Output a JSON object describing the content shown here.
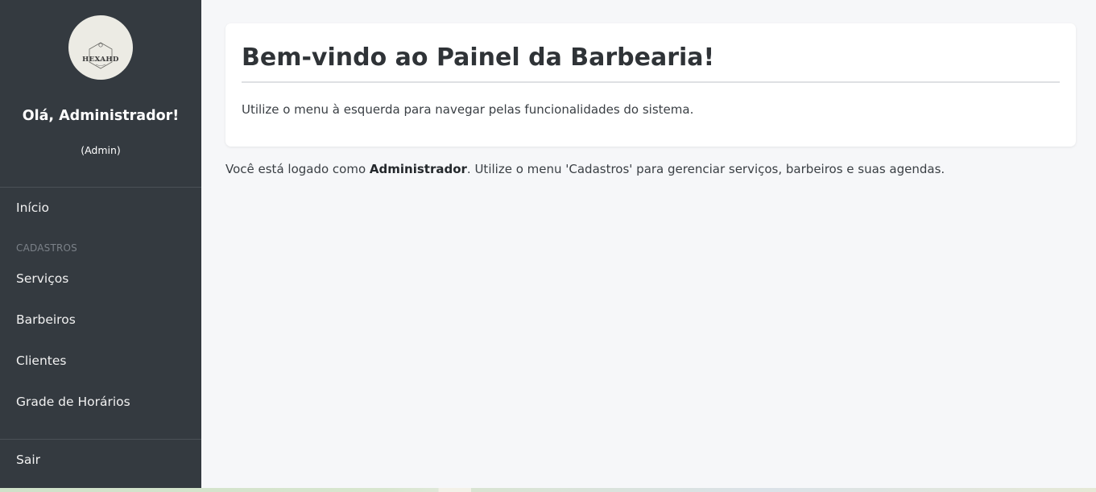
{
  "sidebar": {
    "logo_text": "HEXAHD",
    "greeting": "Olá, Administrador!",
    "role": "(Admin)",
    "items": [
      {
        "label": "Início"
      },
      {
        "label": "Serviços"
      },
      {
        "label": "Barbeiros"
      },
      {
        "label": "Clientes"
      },
      {
        "label": "Grade de Horários"
      }
    ],
    "section_label": "CADASTROS",
    "logout_label": "Sair"
  },
  "main": {
    "card_title": "Bem-vindo ao Painel da Barbearia!",
    "card_text": "Utilize o menu à esquerda para navegar pelas funcionalidades do sistema.",
    "info_prefix": "Você está logado como ",
    "info_role": "Administrador",
    "info_suffix": ". Utilize o menu 'Cadastros' para gerenciar serviços, barbeiros e suas agendas."
  },
  "colors": {
    "sidebar_bg": "#343a40",
    "main_bg": "#f6f7f9",
    "card_bg": "#ffffff"
  }
}
